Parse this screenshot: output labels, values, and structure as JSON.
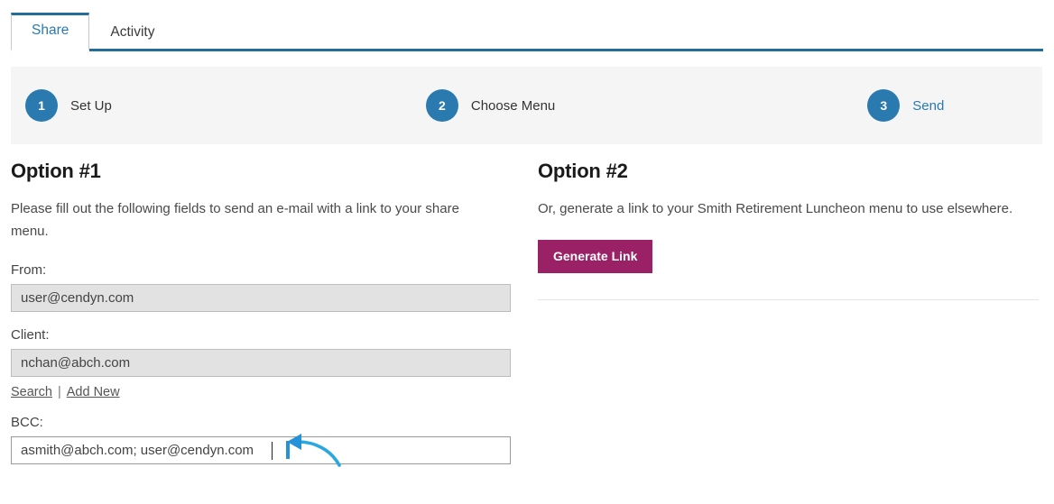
{
  "tabs": [
    {
      "label": "Share",
      "active": true
    },
    {
      "label": "Activity",
      "active": false
    }
  ],
  "steps": [
    {
      "number": "1",
      "label": "Set Up",
      "state": "normal"
    },
    {
      "number": "2",
      "label": "Choose Menu",
      "state": "normal"
    },
    {
      "number": "3",
      "label": "Send",
      "state": "link"
    }
  ],
  "option1": {
    "title": "Option #1",
    "description": "Please fill out the following fields to send an e-mail with a link to your share menu.",
    "from": {
      "label": "From:",
      "value": "user@cendyn.com"
    },
    "client": {
      "label": "Client:",
      "value": "nchan@abch.com",
      "search_link": "Search",
      "separator": "|",
      "add_new_link": "Add New"
    },
    "bcc": {
      "label": "BCC:",
      "value": "asmith@abch.com; user@cendyn.com"
    }
  },
  "option2": {
    "title": "Option #2",
    "description": "Or, generate a link to your Smith Retirement Luncheon menu to use elsewhere.",
    "generate_button": "Generate Link"
  },
  "colors": {
    "accent_blue": "#2A7AB0",
    "tab_underline": "#236C9C",
    "generate_button": "#9B2167",
    "steps_bar_bg": "#F5F5F5",
    "annotation_arrow": "#23A4E0"
  },
  "annotation": {
    "icon": "curved-arrow-left-icon"
  }
}
